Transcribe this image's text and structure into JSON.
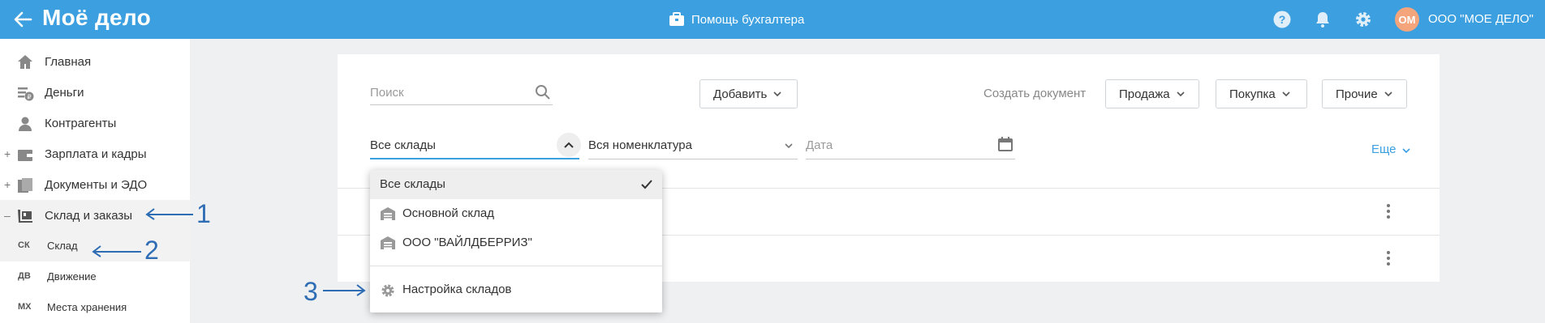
{
  "header": {
    "logo": "Моё дело",
    "help_label": "Помощь бухгалтера",
    "avatar_initials": "ОМ",
    "org_name": "ООО \"МОЕ ДЕЛО\"",
    "icons": [
      "back-arrow-icon",
      "briefcase-icon",
      "help-icon",
      "bell-icon",
      "gear-icon"
    ]
  },
  "sidebar": {
    "items": [
      {
        "label": "Главная",
        "icon": "home-icon",
        "expand": ""
      },
      {
        "label": "Деньги",
        "icon": "money-icon",
        "expand": ""
      },
      {
        "label": "Контрагенты",
        "icon": "contractor-icon",
        "expand": ""
      },
      {
        "label": "Зарплата и кадры",
        "icon": "wallet-icon",
        "expand": "+"
      },
      {
        "label": "Документы и ЭДО",
        "icon": "documents-icon",
        "expand": "+"
      },
      {
        "label": "Склад и заказы",
        "icon": "cart-icon",
        "expand": "–"
      }
    ],
    "subitems": [
      {
        "code": "СК",
        "label": "Склад"
      },
      {
        "code": "ДВ",
        "label": "Движение"
      },
      {
        "code": "МХ",
        "label": "Места хранения"
      }
    ]
  },
  "toolbar": {
    "search_placeholder": "Поиск",
    "add_label": "Добавить",
    "create_doc_label": "Создать документ",
    "sale_label": "Продажа",
    "purchase_label": "Покупка",
    "other_label": "Прочие"
  },
  "filters": {
    "warehouse": "Все склады",
    "nomenclature": "Вся номенклатура",
    "date_placeholder": "Дата",
    "more_label": "Еще"
  },
  "dropdown": {
    "items": [
      {
        "label": "Все склады",
        "selected": true
      },
      {
        "label": "Основной склад",
        "icon": "warehouse-icon"
      },
      {
        "label": "ООО \"ВАЙЛДБЕРРИЗ\"",
        "icon": "warehouse-icon"
      }
    ],
    "settings_label": "Настройка складов"
  },
  "annotations": [
    "1",
    "2",
    "3"
  ],
  "colors": {
    "accent": "#3c9fe0",
    "annotation": "#2e6db4",
    "avatar": "#f5a57b"
  }
}
